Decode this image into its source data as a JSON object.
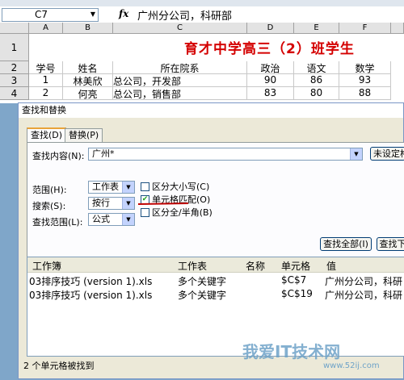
{
  "excel": {
    "name_box": "C7",
    "fx": "fx",
    "formula": "广州分公司，科研部",
    "columns": [
      "A",
      "B",
      "C",
      "D",
      "E",
      "F"
    ],
    "rows": [
      "1",
      "2",
      "3",
      "4"
    ],
    "sheet_title": "育才中学高三（2）班学生",
    "header_row": [
      "学号",
      "姓名",
      "所在院系",
      "政治",
      "语文",
      "数学"
    ],
    "data_rows": [
      [
        "1",
        "林美欣",
        "总公司，开发部",
        "90",
        "86",
        "93"
      ],
      [
        "2",
        "何亮",
        "总公司，销售部",
        "83",
        "80",
        "88"
      ]
    ]
  },
  "dialog": {
    "title": "查找和替换",
    "tabs": [
      "查找(D)",
      "替换(P)"
    ],
    "find_label": "查找内容(N):",
    "find_value": "广州*",
    "format_button": "未设定格",
    "within_label": "范围(H):",
    "within_value": "工作表",
    "search_label": "搜索(S):",
    "search_value": "按行",
    "lookin_label": "查找范围(L):",
    "lookin_value": "公式",
    "options": {
      "match_case": {
        "label": "区分大小写(C)",
        "checked": false
      },
      "match_cell": {
        "label": "单元格匹配(O)",
        "checked": true
      },
      "match_width": {
        "label": "区分全/半角(B)",
        "checked": false
      }
    },
    "find_all_button": "查找全部(I)",
    "find_next_button": "查找下",
    "results": {
      "headers": [
        "工作簿",
        "工作表",
        "名称",
        "单元格",
        "值"
      ],
      "rows": [
        [
          "03排序技巧 (version 1).xls",
          "多个关键字",
          "",
          "$C$7",
          "广州分公司，科研"
        ],
        [
          "03排序技巧 (version 1).xls",
          "多个关键字",
          "",
          "$C$19",
          "广州分公司，科研"
        ]
      ]
    },
    "status": "2 个单元格被找到"
  },
  "watermark": "我爱IT技术网",
  "watermark_url": "www.52ij.com",
  "colors": {
    "title_red": "#d40000",
    "annotation": "#c00000",
    "dialog_bg": "#ece9d8"
  }
}
